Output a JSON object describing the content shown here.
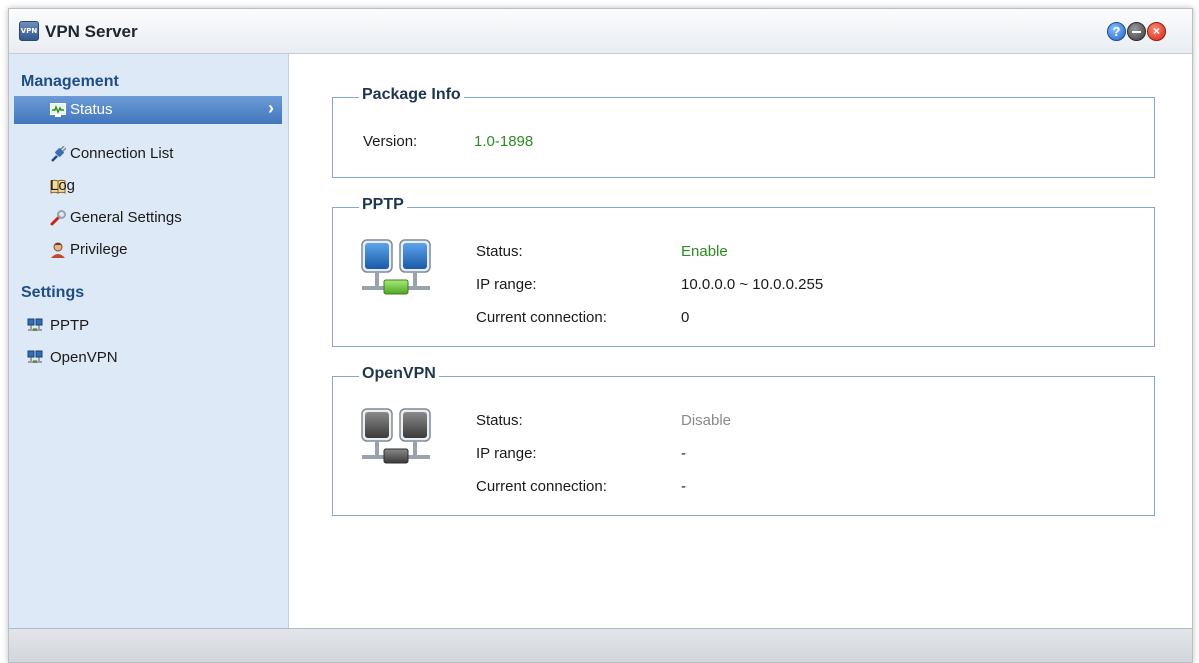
{
  "window": {
    "title": "VPN Server",
    "app_icon_text": "VPN",
    "controls": {
      "help": "?",
      "minimize": "",
      "close": "×"
    }
  },
  "sidebar": {
    "management": {
      "title": "Management",
      "items": [
        {
          "label": "Status",
          "icon": "monitor-icon",
          "active": true
        },
        {
          "label": "Connection List",
          "icon": "plug-icon"
        },
        {
          "label": "Log",
          "icon": "book-icon"
        },
        {
          "label": "General Settings",
          "icon": "wrench-icon"
        },
        {
          "label": "Privilege",
          "icon": "user-icon"
        }
      ]
    },
    "settings": {
      "title": "Settings",
      "items": [
        {
          "label": "PPTP",
          "icon": "network-icon"
        },
        {
          "label": "OpenVPN",
          "icon": "network-icon"
        }
      ]
    }
  },
  "main": {
    "package_info": {
      "title": "Package Info",
      "version_label": "Version:",
      "version_value": "1.0-1898"
    },
    "pptp": {
      "title": "PPTP",
      "status_label": "Status:",
      "status_value": "Enable",
      "ip_range_label": "IP range:",
      "ip_range_value": "10.0.0.0 ~ 10.0.0.255",
      "current_connection_label": "Current connection:",
      "current_connection_value": "0"
    },
    "openvpn": {
      "title": "OpenVPN",
      "status_label": "Status:",
      "status_value": "Disable",
      "ip_range_label": "IP range:",
      "ip_range_value": "-",
      "current_connection_label": "Current connection:",
      "current_connection_value": "-"
    }
  },
  "colors": {
    "accent": "#4376bd",
    "sidebar_bg": "#dde9f6",
    "enabled_green": "#2e8b22",
    "disabled_grey": "#8a8a8a",
    "group_border": "#86a8cf"
  }
}
